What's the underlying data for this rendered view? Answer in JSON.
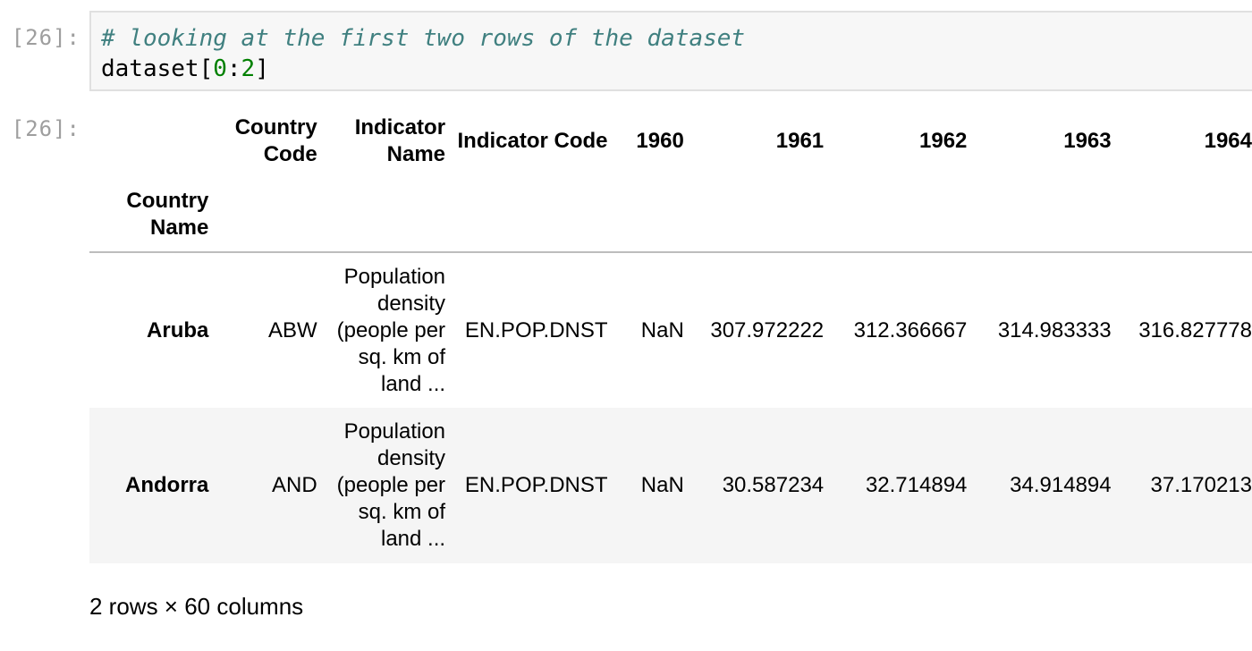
{
  "input_cell": {
    "prompt": "[26]:",
    "comment": "# looking at the first two rows of the dataset",
    "code_prefix": "dataset[",
    "code_num1": "0",
    "code_colon": ":",
    "code_num2": "2",
    "code_suffix": "]"
  },
  "output_cell": {
    "prompt": "[26]:",
    "index_name": "Country Name",
    "columns": [
      "Country Code",
      "Indicator Name",
      "Indicator Code",
      "1960",
      "1961",
      "1962",
      "1963",
      "1964"
    ],
    "rows": [
      {
        "index": "Aruba",
        "values": [
          "ABW",
          "Population density (people per sq. km of land ...",
          "EN.POP.DNST",
          "NaN",
          "307.972222",
          "312.366667",
          "314.983333",
          "316.827778"
        ]
      },
      {
        "index": "Andorra",
        "values": [
          "AND",
          "Population density (people per sq. km of land ...",
          "EN.POP.DNST",
          "NaN",
          "30.587234",
          "32.714894",
          "34.914894",
          "37.170213"
        ]
      }
    ],
    "summary": "2 rows × 60 columns"
  }
}
